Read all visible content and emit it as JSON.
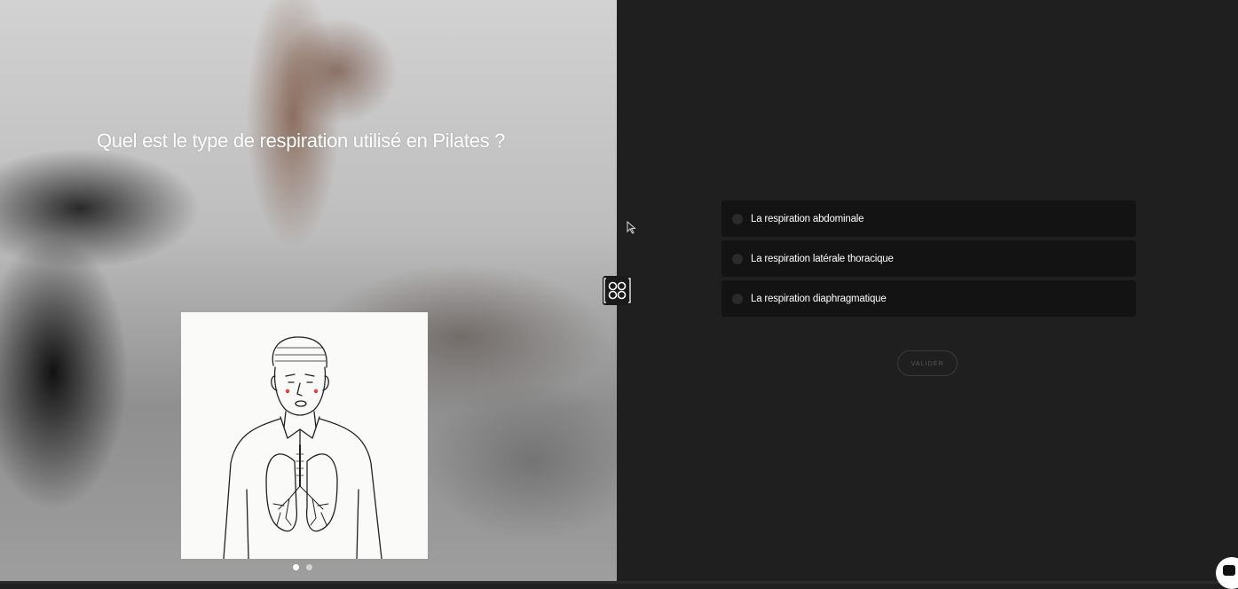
{
  "question": {
    "title": "Quel est le type de respiration utilisé en Pilates ?"
  },
  "illustration": {
    "icon": "lungs-illustration-icon"
  },
  "carousel": {
    "slides": 2,
    "active_index": 0
  },
  "answers": [
    {
      "label": "La respiration abdominale",
      "selected": false
    },
    {
      "label": "La respiration latérale thoracique",
      "selected": false
    },
    {
      "label": "La respiration diaphragmatique",
      "selected": false
    }
  ],
  "validate_button": {
    "label": "VALIDER"
  },
  "icons": {
    "logo": "brand-logo-icon",
    "cursor": "mouse-cursor-icon",
    "chat": "chat-icon"
  },
  "colors": {
    "background": "#1f1f1f",
    "answer_bg": "#131313",
    "title_text": "#ffffff"
  }
}
